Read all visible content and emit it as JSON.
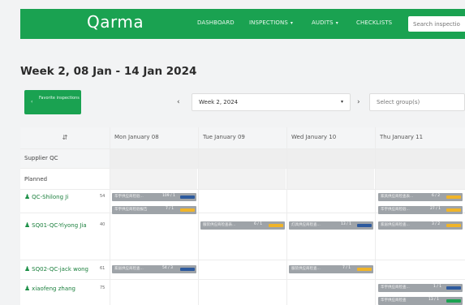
{
  "nav": {
    "logo": "Qarma",
    "items": [
      {
        "label": "DASHBOARD",
        "caret": ""
      },
      {
        "label": "INSPECTIONS",
        "caret": "▾"
      },
      {
        "label": "AUDITS",
        "caret": "▾"
      },
      {
        "label": "CHECKLISTS",
        "caret": ""
      }
    ],
    "search_placeholder": "Search inspectio"
  },
  "page": {
    "title": "Week 2, 08 Jan - 14 Jan 2024",
    "favorite_button": "Favorite inspections",
    "favorite_arrow": "‹",
    "prev_arrow": "‹",
    "next_arrow": "›",
    "week_value": "Week 2, 2024",
    "week_caret": "▾",
    "group_placeholder": "Select group(s)"
  },
  "grid": {
    "sort_icon": "⇵",
    "days": [
      "Mon January 08",
      "Tue January 09",
      "Wed January 10",
      "Thu January 11"
    ],
    "section": "Supplier QC",
    "planned_label": "Planned",
    "users": [
      {
        "name": "QC-Shilong Ji",
        "count": "54"
      },
      {
        "name": "SQ01-QC-Yiyong Jia",
        "count": "40"
      },
      {
        "name": "SQ02-QC-jack wong",
        "count": "61"
      },
      {
        "name": "xiaofeng zhang",
        "count": "75"
      }
    ],
    "chips": [
      {
        "text": "华宇供应商检验...",
        "count": "109 / 1",
        "bar": "#2d5a9e"
      },
      {
        "text": "华宇供应商检验报告",
        "count": "7 / 1",
        "bar": "#f0b429"
      },
      {
        "text": "家具供应商检查表...",
        "count": "6 / 2",
        "bar": "#f0b429"
      },
      {
        "text": "华宇供应商检验...",
        "count": "27 / 1",
        "bar": "#f0b429"
      },
      {
        "text": "服装供应商检查表...",
        "count": "6 / 1",
        "bar": "#f0b429"
      },
      {
        "text": "灯具供应商检查...",
        "count": "13 / 1",
        "bar": "#2d5a9e"
      },
      {
        "text": "家居供应商检查...",
        "count": "3 / 2",
        "bar": "#f0b429"
      },
      {
        "text": "家居供应商检查...",
        "count": "54 / 3",
        "bar": "#2d5a9e"
      },
      {
        "text": "服装供应商检查...",
        "count": "7 / 1",
        "bar": "#f0b429"
      },
      {
        "text": "华宇供应商检查...",
        "count": "1 / 1",
        "bar": "#2d5a9e"
      },
      {
        "text": "华宇供应商检查",
        "count": "13 / 1",
        "bar": "#1aa251"
      }
    ]
  }
}
